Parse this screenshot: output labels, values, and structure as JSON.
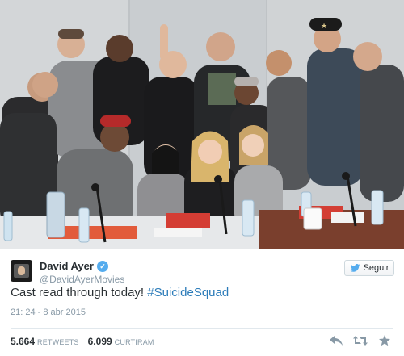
{
  "tweet": {
    "display_name": "David Ayer",
    "handle": "@DavidAyerMovies",
    "verified_icon": "check-icon",
    "follow_label": "Seguir",
    "text_prefix": "Cast read through today! ",
    "hashtag": "#SuicideSquad",
    "timestamp": "21: 24 - 8 abr 2015",
    "retweets_count": "5.664",
    "retweets_label": "RETWEETS",
    "likes_count": "6.099",
    "likes_label": "CURTIRAM"
  },
  "photo": {
    "cap_text": "★"
  },
  "colors": {
    "link": "#2b7bb9",
    "verified": "#55acee",
    "muted": "#8899a6",
    "text": "#292f33"
  },
  "icons": [
    "reply-icon",
    "retweet-icon",
    "favorite-icon",
    "twitter-bird-icon"
  ]
}
